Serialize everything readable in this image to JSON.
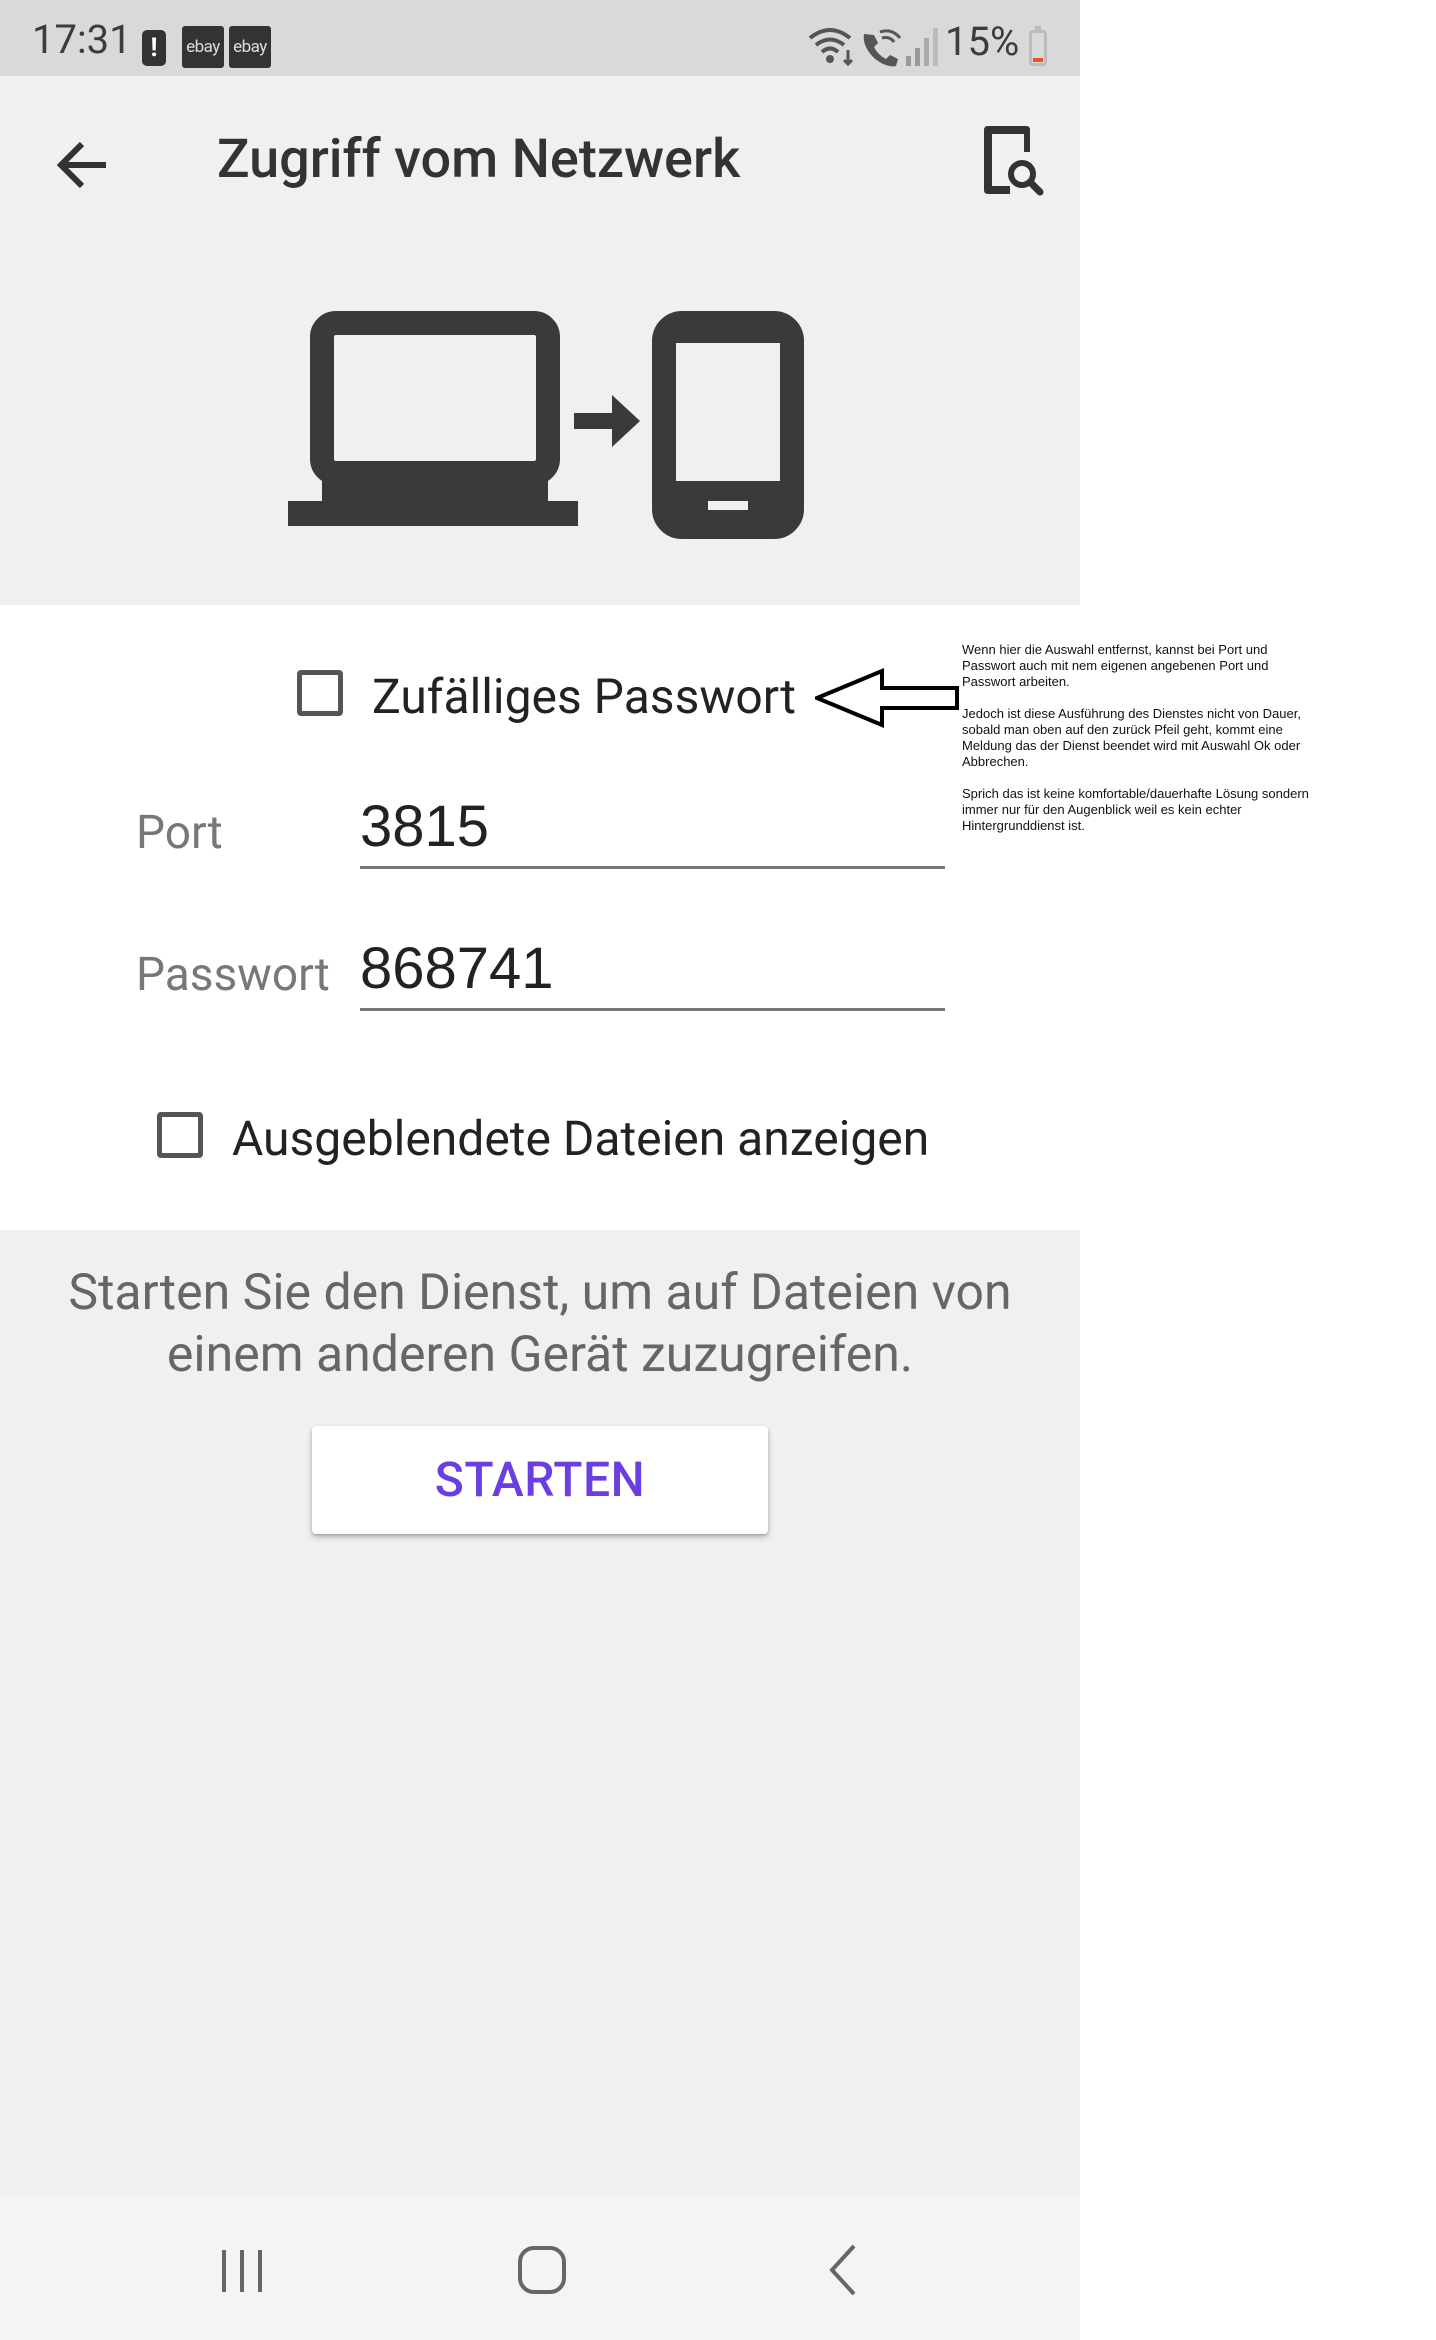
{
  "status_bar": {
    "time": "17:31",
    "alert_icon": "!",
    "app_badges": [
      "ebay",
      "ebay"
    ],
    "battery": "15%"
  },
  "app_bar": {
    "title": "Zugriff vom Netzwerk"
  },
  "settings": {
    "random_password_label": "Zufälliges Passwort",
    "random_password_checked": false,
    "port_label": "Port",
    "port_value": "3815",
    "password_label": "Passwort",
    "password_value": "868741",
    "hidden_files_label": "Ausgeblendete Dateien anzeigen",
    "hidden_files_checked": false
  },
  "start": {
    "hint_line1": "Starten Sie den Dienst, um auf Dateien von",
    "hint_line2": "einem anderen Gerät zuzugreifen.",
    "button_label": "STARTEN"
  },
  "annotation": {
    "paragraph1": "Wenn hier die Auswahl entfernst, kannst bei Port und Passwort auch mit nem eigenen angebenen Port und Passwort arbeiten.",
    "paragraph2": "Jedoch ist diese Ausführung des Dienstes nicht von Dauer, sobald man oben auf den zurück Pfeil geht, kommt eine Meldung das der Dienst beendet wird mit Auswahl Ok oder Abbrechen.",
    "paragraph3": "Sprich das ist keine komfortable/dauerhafte Lösung sondern immer nur für den Augenblick weil es kein echter Hintergrunddienst ist."
  },
  "colors": {
    "accent": "#6a3ee0",
    "background": "#f0f0f0",
    "card": "#ffffff",
    "icon": "#3a3a3a"
  }
}
